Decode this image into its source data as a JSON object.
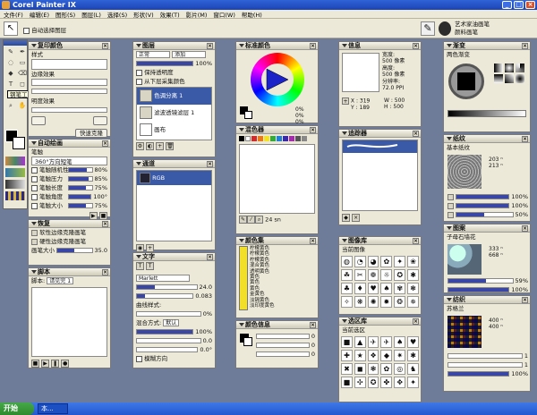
{
  "app": {
    "title": "Corel Painter IX"
  },
  "menu": [
    "文件(F)",
    "编辑(E)",
    "图形(S)",
    "图层(L)",
    "选择(S)",
    "形状(V)",
    "效果(T)",
    "影片(M)",
    "窗口(W)",
    "帮助(H)"
  ],
  "propbar": {
    "checkbox_label": "自动选择图层",
    "brush_category": "艺术家油画笔",
    "brush_variant": "颜料画笔"
  },
  "toolbox": {
    "tooltip": "钢笔工具"
  },
  "clone": {
    "title": "复印颜色",
    "style_label": "样式",
    "edge_label": "边缘效果",
    "quick_clone": "快速克隆",
    "shape_label": "明度效果"
  },
  "auto_paint": {
    "title": "自动绘画",
    "brush_label": "笔触",
    "brush_value": "360°方向短笔",
    "rows": [
      {
        "label": "笔触随机性",
        "value": "80%",
        "pct": 0.8
      },
      {
        "label": "笔触压力",
        "value": "85%",
        "pct": 0.85
      },
      {
        "label": "笔触长度",
        "value": "75%",
        "pct": 0.75
      },
      {
        "label": "笔触角度",
        "value": "100°",
        "pct": 1.0
      },
      {
        "label": "笔触大小",
        "value": "75%",
        "pct": 0.75
      }
    ]
  },
  "restore": {
    "title": "恢复",
    "opt1": "软性边缘克隆画笔",
    "opt2": "硬性边缘克隆画笔",
    "size_label": "画笔大小",
    "size_value": "35.0"
  },
  "script": {
    "title": "脚本",
    "label": "脚本:",
    "value": "请见完 1"
  },
  "layers": {
    "title": "图层",
    "mode": "正常",
    "composite": "添加",
    "opacity": "100%",
    "preserve": "保持透明度",
    "pick": "从下层采集颜色",
    "items": [
      "色调分离 1",
      "滤波透镜滤层 1",
      "画布"
    ]
  },
  "channels": {
    "title": "通道",
    "items": [
      "RGB"
    ]
  },
  "text": {
    "title": "文字",
    "font": "Marlett",
    "size": "24.0",
    "tracking": "0.083",
    "baseline": "0%",
    "curve_label": "曲线样式:",
    "blend_label": "混合方式:",
    "blend_value": "默认",
    "opacity": "100%",
    "shadow": "0.0",
    "angle": "0.0°",
    "blur_check": "模糊方向"
  },
  "std_colors": {
    "title": "标准颜色",
    "h": "0%",
    "s": "0%",
    "v": "0%"
  },
  "mixer": {
    "title": "混色器",
    "size": "24 sn",
    "swatches": [
      "#000000",
      "#ffffff",
      "#d42a2a",
      "#e87a1e",
      "#f5e21e",
      "#37a93a",
      "#1e80d9",
      "#3a2aa6",
      "#a62ab0",
      "#555555",
      "#888888"
    ]
  },
  "color_set": {
    "title": "颜色集",
    "items": [
      "柠檬黄色",
      "柠檬黄色",
      "柠檬黄色",
      "混合黄色",
      "透明黄色",
      "黄色",
      "黄色",
      "黄色",
      "金黄色",
      "淡镉黄色",
      "淡印度黄色"
    ]
  },
  "color_info": {
    "title": "颜色信息",
    "r": "0",
    "g": "0",
    "b": "0"
  },
  "info": {
    "title": "信息",
    "width_label": "宽度:",
    "width_val": "500 像素",
    "height_label": "高度:",
    "height_val": "500 像素",
    "res_label": "分辨率:",
    "res_val": "72.0 PPI",
    "x_label": "X :",
    "x_val": "319",
    "y_label": "Y :",
    "y_val": "189",
    "w_label": "W :",
    "w_val": "500",
    "h_label": "H :",
    "h_val": "500"
  },
  "tracker": {
    "title": "追踪器"
  },
  "library": {
    "title": "图像库",
    "label": "当前图像"
  },
  "selection": {
    "title": "选区库",
    "label": "当前选区"
  },
  "gradient": {
    "title": "渐变",
    "label": "两色渐变"
  },
  "paper": {
    "title": "纸纹",
    "label": "基本纸纹",
    "v1": "203 ⁿ",
    "v2": "213 ⁿ",
    "p1": "100%",
    "p2": "100%",
    "p3": "50%",
    "p1v": 1,
    "p2v": 1,
    "p3v": 0.5
  },
  "pattern": {
    "title": "图案",
    "label": "子母石墙花",
    "v1": "333 ⁿ",
    "v2": "668 ⁿ",
    "p1": "59%",
    "p2": "100%",
    "p1v": 0.59,
    "p2v": 1
  },
  "weave": {
    "title": "纺织",
    "label": "苏格兰",
    "v1": "400 ⁿ",
    "v2": "400 ⁿ",
    "p1": "1",
    "p2": "1",
    "p3": "100%"
  },
  "taskbar": {
    "start": "开始",
    "item": "本..."
  }
}
